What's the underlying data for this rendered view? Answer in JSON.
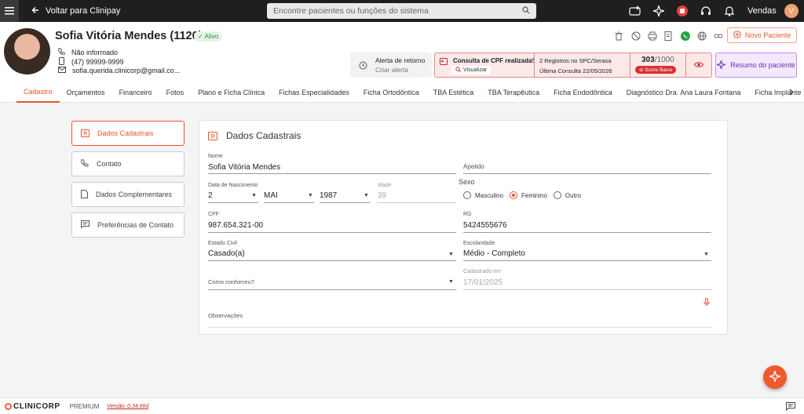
{
  "topbar": {
    "back_label": "Voltar para Clinipay",
    "search_placeholder": "Encontre pacientes ou funções do sistema",
    "user_label": "Vendas",
    "user_initial": "V"
  },
  "patient": {
    "name": "Sofia Vitória Mendes (1120)",
    "status": "Ativo",
    "phone": "Não informado",
    "mobile": "(47) 99999-9999",
    "email": "sofia.querida.clinicorp@gmail.co..."
  },
  "actions": {
    "new_patient": "Novo Paciente",
    "alert_title": "Alerta de retorno",
    "alert_sub": "Criar alerta",
    "cpf_title": "Consulta de CPF realizada!",
    "cpf_view": "Visualizar",
    "cpf_registros": "2 Registros no SPC/Serasa",
    "cpf_ultima": "Última Consulta 22/05/2026",
    "score_value": "303",
    "score_max": "/1000",
    "score_label": "Score Baixo",
    "summary": "Resumo do paciente"
  },
  "tabs": [
    {
      "label": "Cadastro"
    },
    {
      "label": "Orçamentos"
    },
    {
      "label": "Financeiro"
    },
    {
      "label": "Fotos"
    },
    {
      "label": "Plano e Ficha Clínica"
    },
    {
      "label": "Fichas Especialidades"
    },
    {
      "label": "Ficha Ortodôntica"
    },
    {
      "label": "TBA Estética"
    },
    {
      "label": "TBA Terapêutica"
    },
    {
      "label": "Ficha Endodôntica"
    },
    {
      "label": "Diagnóstico Dra. Ana Laura Fontana"
    },
    {
      "label": "Ficha Implante"
    }
  ],
  "sidebar": [
    {
      "label": "Dados Cadastrais"
    },
    {
      "label": "Contato"
    },
    {
      "label": "Dados Complementares"
    },
    {
      "label": "Preferências de Contato"
    }
  ],
  "form": {
    "title": "Dados Cadastrais",
    "nome_label": "Nome",
    "nome_value": "Sofia Vitória Mendes",
    "apelido_label": "Apelido",
    "nasc_label": "Data de Nascimento",
    "nasc_day": "2",
    "nasc_month": "MAI",
    "nasc_year": "1987",
    "idade_label": "Idade",
    "idade_value": "39",
    "sexo_label": "Sexo",
    "sexo_m": "Masculino",
    "sexo_f": "Feminino",
    "sexo_o": "Outro",
    "cpf_label": "CPF",
    "cpf_value": "987.654.321-00",
    "rg_label": "RG",
    "rg_value": "5424555676",
    "civil_label": "Estado Civil",
    "civil_value": "Casado(a)",
    "escolaridade_label": "Escolaridade",
    "escolaridade_value": "Médio - Completo",
    "conheceu_label": "Como conheceu?",
    "cadastrado_label": "Cadastrado em",
    "cadastrado_value": "17/01/2025",
    "obs_label": "Observações"
  },
  "footer": {
    "brand": "CLINICORP",
    "plan": "PREMIUM",
    "version": "Versão: 0.34.66d"
  },
  "colors": {
    "accent": "#e8572b",
    "dark": "#1f1f1f"
  }
}
